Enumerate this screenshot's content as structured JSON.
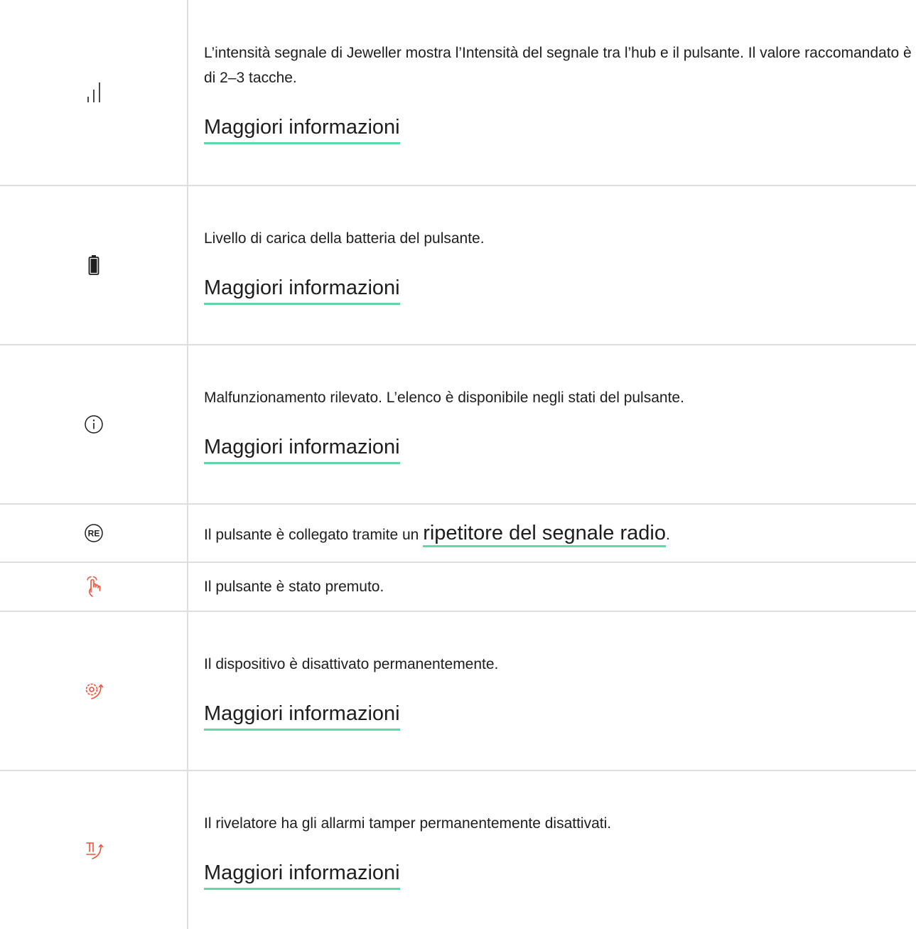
{
  "colors": {
    "text": "#1d1d1d",
    "divider": "#dedede",
    "link_underline": "#5fd8a7",
    "icon_dark": "#1d1d1d",
    "icon_alert": "#f0513a"
  },
  "rows": [
    {
      "icon": "signal-strength-icon",
      "text": "L’intensità segnale di Jeweller mostra l’Intensità del segnale tra l’hub e il pulsante. Il valore raccomandato è di 2–3 tacche.",
      "link": "Maggiori informazioni"
    },
    {
      "icon": "battery-icon",
      "text": "Livello di carica della batteria del pulsante.",
      "link": "Maggiori informazioni"
    },
    {
      "icon": "info-icon",
      "text": "Malfunzionamento rilevato. L’elenco è disponibile negli stati del pulsante.",
      "link": "Maggiori informazioni"
    },
    {
      "icon": "re-repeater-icon",
      "icon_label": "RE",
      "text": "Il pulsante è collegato tramite un ",
      "link": "ripetitore del segnale radio",
      "text_after": "."
    },
    {
      "icon": "finger-press-icon",
      "text": "Il pulsante è stato premuto."
    },
    {
      "icon": "gear-disabled-icon",
      "text": "Il dispositivo è disattivato permanentemente.",
      "link": "Maggiori informazioni"
    },
    {
      "icon": "tamper-disabled-icon",
      "text": "Il rivelatore ha gli allarmi tamper permanentemente disattivati.",
      "link": "Maggiori informazioni"
    }
  ]
}
